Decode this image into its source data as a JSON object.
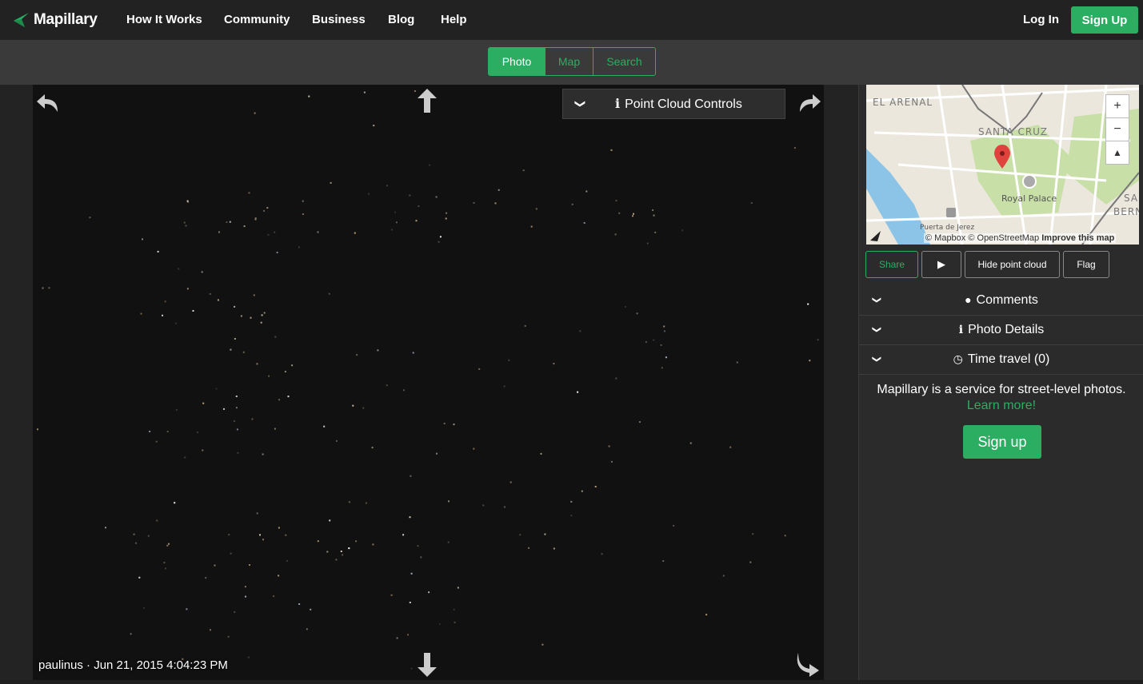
{
  "header": {
    "brand": "Mapillary",
    "nav": [
      "How It Works",
      "Community",
      "Business",
      "Blog",
      "Help"
    ],
    "login": "Log In",
    "signup": "Sign Up"
  },
  "view_tabs": [
    "Photo",
    "Map",
    "Search"
  ],
  "viewer": {
    "point_cloud_controls": "Point Cloud Controls",
    "caption": "paulinus · Jun 21, 2015 4:04:23 PM"
  },
  "map": {
    "labels": {
      "el_arenal": "EL ARENAL",
      "santa_cruz": "SANTA CRUZ",
      "royal_palace": "Royal Palace",
      "puerta_jerez": "Puerta de Jerez",
      "san_bernardo_1": "SAN",
      "san_bernardo_2": "BERNA"
    },
    "zoom_in": "+",
    "zoom_out": "−",
    "attribution": "© Mapbox © OpenStreetMap",
    "improve": "Improve this map"
  },
  "actions": {
    "share": "Share",
    "play": "▶",
    "hide_point_cloud": "Hide point cloud",
    "flag": "Flag"
  },
  "accordion": [
    "Comments",
    "Photo Details",
    "Time travel (0)"
  ],
  "promo": {
    "text": "Mapillary is a service for street-level photos.",
    "learn": "Learn more!",
    "signup": "Sign up"
  },
  "colors": {
    "accent": "#2cae62",
    "navbar": "#222222",
    "subbar": "#3a3a3a"
  }
}
